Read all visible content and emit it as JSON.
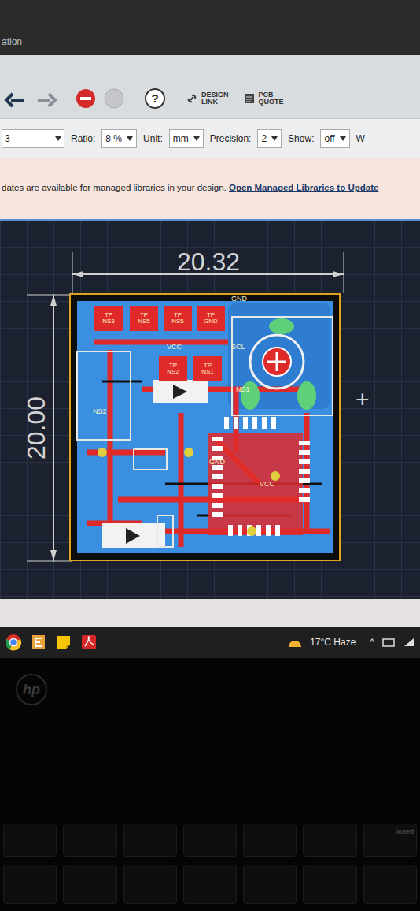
{
  "window": {
    "title": "ation"
  },
  "toolbar": {
    "help": "?",
    "buttons": [
      {
        "lines": [
          "DESIGN",
          "LINK"
        ]
      },
      {
        "lines": [
          "PCB",
          "QUOTE"
        ]
      }
    ]
  },
  "options": {
    "layer": "3",
    "fields": [
      {
        "label": "Ratio:",
        "value": "8 %"
      },
      {
        "label": "Unit:",
        "value": "mm"
      },
      {
        "label": "Precision:",
        "value": "2"
      },
      {
        "label": "Show:",
        "value": "off"
      }
    ],
    "trailing": "W"
  },
  "banner": {
    "text": "dates are available for managed libraries in your design. ",
    "link": "Open Managed Libraries to Update"
  },
  "canvas": {
    "width_dim": "20.32",
    "height_dim": "20.00",
    "cursor": "+",
    "pads": [
      {
        "top": "TP",
        "bottom": "NS3"
      },
      {
        "top": "TP",
        "bottom": "NS5"
      },
      {
        "top": "TP",
        "bottom": "NS5"
      },
      {
        "top": "TP",
        "bottom": "GND"
      },
      {
        "top": "TP",
        "bottom": "NS2"
      },
      {
        "top": "TP",
        "bottom": "NS1"
      }
    ],
    "labels": [
      "GND",
      "VCC",
      "SCL",
      "NS2",
      "NS1",
      "GND",
      "VCC"
    ]
  },
  "taskbar": {
    "weather": "17°C Haze",
    "tray": "^"
  },
  "laptop": {
    "logo": "hp",
    "key": "insert"
  }
}
